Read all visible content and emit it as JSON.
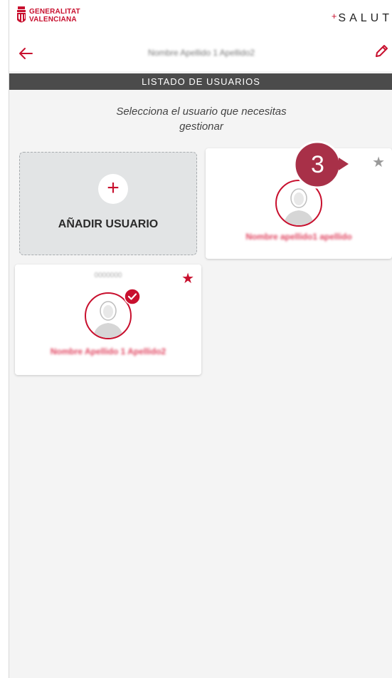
{
  "header": {
    "org_name_line1": "GENERALITAT",
    "org_name_line2": "VALENCIANA",
    "brand": "SALUT",
    "brand_plus": "+"
  },
  "nav": {
    "title": "Nombre Apellido 1 Apellido2",
    "back_icon": "arrow-left-icon",
    "edit_icon": "pencil-icon"
  },
  "section": {
    "title": "LISTADO DE USUARIOS"
  },
  "subtitle_line1": "Selecciona el usuario que necesitas",
  "subtitle_line2": "gestionar",
  "add_card": {
    "plus": "+",
    "label": "AÑADIR USUARIO"
  },
  "users": [
    {
      "id": "1",
      "name": "Nombre apellido1 apellido",
      "favorite": false,
      "selected": false
    },
    {
      "id": "0000000",
      "name": "Nombre Apellido 1 Apellido2",
      "favorite": true,
      "selected": true
    }
  ],
  "step_badge": {
    "number": "3"
  },
  "colors": {
    "brand_red": "#c8102e",
    "section_bar": "#4b4b4b",
    "step_badge": "#a83048",
    "background": "#f4f4f4"
  }
}
